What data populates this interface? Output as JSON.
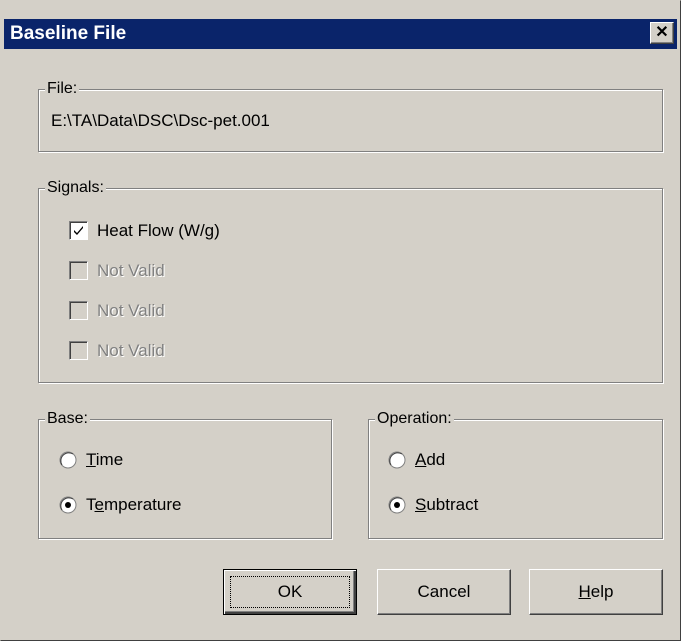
{
  "window": {
    "title": "Baseline File",
    "close_glyph": "✕"
  },
  "file_group": {
    "legend": "File:",
    "path": "E:\\TA\\Data\\DSC\\Dsc-pet.001"
  },
  "signals_group": {
    "legend": "Signals:",
    "items": [
      {
        "label": "Heat Flow (W/g)",
        "checked": true,
        "enabled": true
      },
      {
        "label": "Not Valid",
        "checked": false,
        "enabled": false
      },
      {
        "label": "Not Valid",
        "checked": false,
        "enabled": false
      },
      {
        "label": "Not Valid",
        "checked": false,
        "enabled": false
      }
    ]
  },
  "base_group": {
    "legend": "Base:",
    "options": [
      {
        "label_pre": "",
        "mnemonic": "T",
        "label_post": "ime",
        "selected": false
      },
      {
        "label_pre": "T",
        "mnemonic": "e",
        "label_post": "mperature",
        "selected": true
      }
    ]
  },
  "operation_group": {
    "legend": "Operation:",
    "options": [
      {
        "label_pre": "",
        "mnemonic": "A",
        "label_post": "dd",
        "selected": false
      },
      {
        "label_pre": "",
        "mnemonic": "S",
        "label_post": "ubtract",
        "selected": true
      }
    ]
  },
  "buttons": {
    "ok": "OK",
    "cancel": "Cancel",
    "help_pre": "",
    "help_mnemonic": "H",
    "help_post": "elp"
  },
  "colors": {
    "face": "#d4d0c8",
    "titlebar": "#0a246a",
    "disabled_text": "#808080"
  },
  "icons": {
    "close": "close-icon",
    "check": "checkmark-icon",
    "radio_dot": "radio-dot-icon"
  }
}
